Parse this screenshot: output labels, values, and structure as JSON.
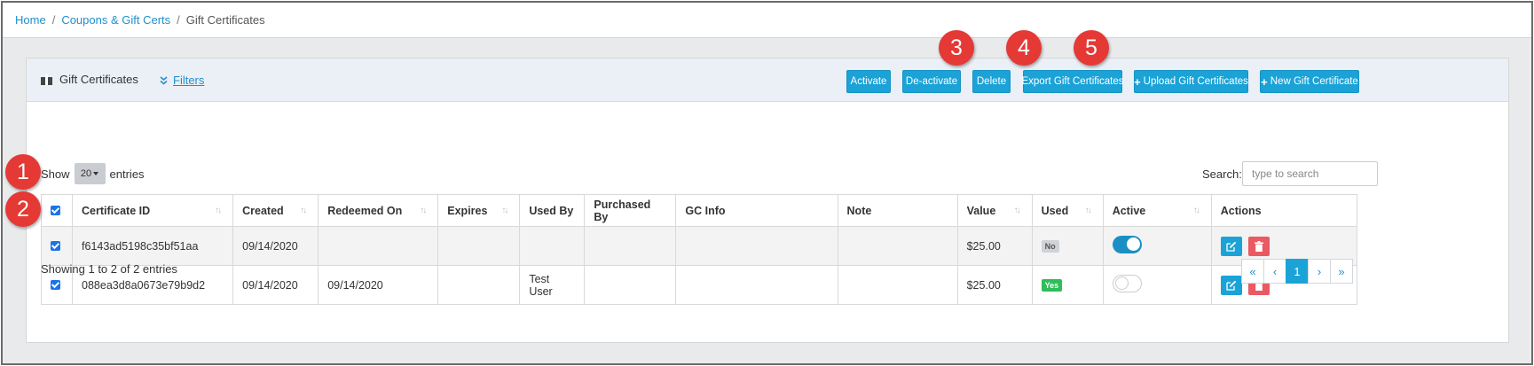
{
  "breadcrumb": {
    "home": "Home",
    "coupons": "Coupons & Gift Certs",
    "current": "Gift Certificates",
    "separator": "/"
  },
  "card": {
    "title": "Gift Certificates",
    "filters_label": "Filters",
    "icons": {
      "title": "gift-icon",
      "filters": "double-chevron-down-icon"
    }
  },
  "toolbar": {
    "activate": "Activate",
    "deactivate": "De-activate",
    "delete": "Delete",
    "export": "Export Gift Certificates",
    "upload": "Upload Gift Certificates",
    "new": "New Gift Certificate",
    "plus": "+"
  },
  "callouts": [
    "1",
    "2",
    "3",
    "4",
    "5"
  ],
  "table_controls": {
    "show_label": "Show",
    "page_size": "20",
    "entries_label": "entries",
    "search_label": "Search:",
    "search_placeholder": "type to search"
  },
  "table": {
    "columns": [
      "Certificate ID",
      "Created",
      "Redeemed On",
      "Expires",
      "Used By",
      "Purchased By",
      "GC Info",
      "Note",
      "Value",
      "Used",
      "Active",
      "Actions"
    ],
    "sort_glyph": "↑↓",
    "rows": [
      {
        "id": "f6143ad5198c35bf51aa",
        "created": "09/14/2020",
        "redeemed": "",
        "expires": "",
        "used_by": "",
        "purchased_by": "",
        "gc_info": "",
        "note": "",
        "value": "$25.00",
        "used": "No",
        "active": true,
        "checked": true
      },
      {
        "id": "088ea3d8a0673e79b9d2",
        "created": "09/14/2020",
        "redeemed": "09/14/2020",
        "expires": "",
        "used_by": "Test User",
        "purchased_by": "",
        "gc_info": "",
        "note": "",
        "value": "$25.00",
        "used": "Yes",
        "active": false,
        "checked": true
      }
    ]
  },
  "footer": {
    "showing": "Showing 1 to 2 of 2 entries",
    "pager": [
      "«",
      "‹",
      "1",
      "›",
      "»"
    ],
    "current_page": "1"
  },
  "colors": {
    "primary": "#1ba3d7",
    "danger": "#ea5a62",
    "callout": "#e53935",
    "success": "#2ebd59"
  }
}
